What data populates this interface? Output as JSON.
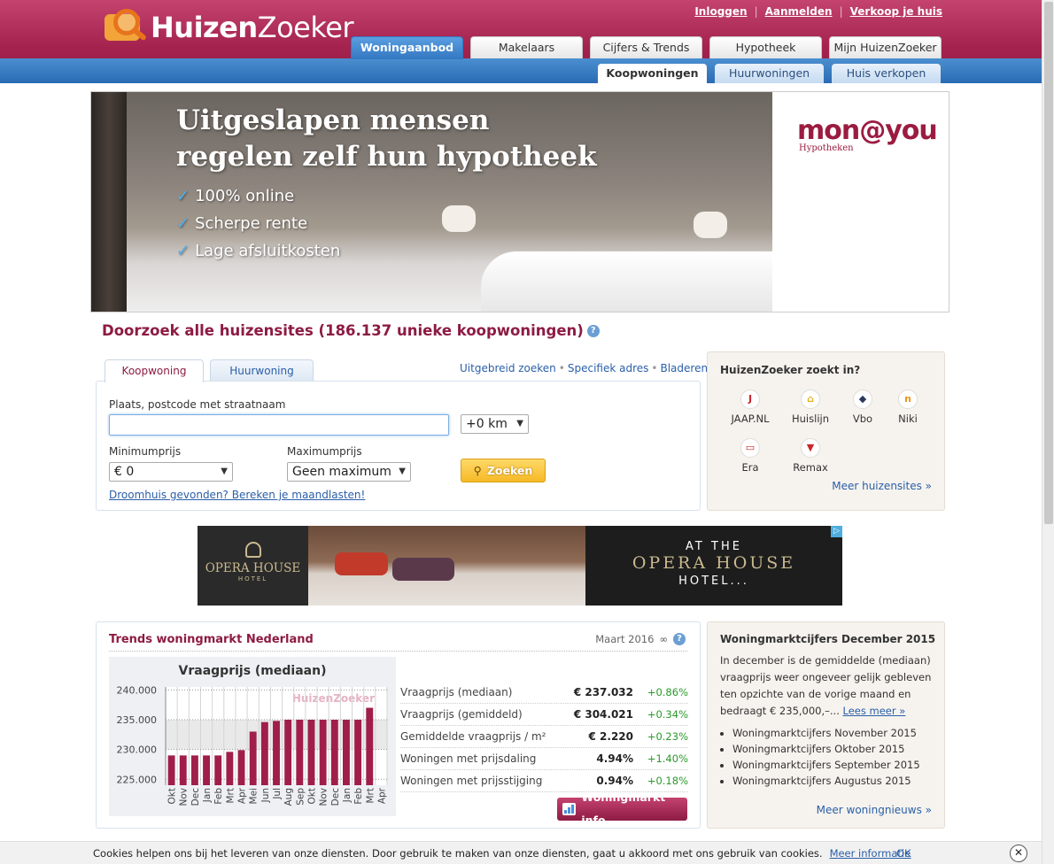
{
  "header": {
    "brand_bold": "Huizen",
    "brand_light": "Zoeker",
    "links": [
      "Inloggen",
      "Aanmelden",
      "Verkoop je huis"
    ],
    "separator": "|",
    "main_tabs": [
      "Woningaanbod",
      "Makelaars",
      "Cijfers & Trends",
      "Hypotheek",
      "Mijn HuizenZoeker"
    ],
    "sub_tabs": [
      "Koopwoningen",
      "Huurwoningen",
      "Huis verkopen"
    ]
  },
  "banner": {
    "headline_1": "Uitgeslapen mensen",
    "headline_2": "regelen zelf hun hypotheek",
    "check_mark": "✓",
    "points": [
      "100% online",
      "Scherpe rente",
      "Lage afsluitkosten"
    ],
    "brand": "mon@you",
    "brand_sub": "Hypotheken"
  },
  "search": {
    "title": "Doorzoek alle huizensites (186.137 unieke koopwoningen)",
    "help_icon": "?",
    "tabs": [
      "Koopwoning",
      "Huurwoning"
    ],
    "links": [
      "Uitgebreid zoeken",
      "Specifiek adres",
      "Bladeren"
    ],
    "link_separator": "•",
    "place_label": "Plaats, postcode met straatnaam",
    "place_value": "",
    "distance": "+0 km",
    "min_label": "Minimumprijs",
    "min_value": "€ 0",
    "max_label": "Maximumprijs",
    "max_value": "Geen maximum",
    "search_button": "Zoeken",
    "dream_link": "Droomhuis gevonden? Bereken je maandlasten!"
  },
  "sites": {
    "title": "HuizenZoeker zoekt in?",
    "items": [
      {
        "name": "JAAP.NL",
        "icon": "J",
        "color": "#c8262a"
      },
      {
        "name": "Huislijn",
        "icon": "⌂",
        "color": "#e3b21c"
      },
      {
        "name": "Vbo",
        "icon": "◆",
        "color": "#2a3a5e"
      },
      {
        "name": "Niki",
        "icon": "n",
        "color": "#e8961c"
      },
      {
        "name": "Era",
        "icon": "▭",
        "color": "#c8262a"
      },
      {
        "name": "Remax",
        "icon": "▼",
        "color": "#c8262a"
      }
    ],
    "more": "Meer huizensites »"
  },
  "ad": {
    "logo_name": "OPERA HOUSE",
    "logo_sub": "HOTEL",
    "line1": "AT THE",
    "line2": "OPERA HOUSE",
    "line3": "HOTEL...",
    "adchoice": "▷"
  },
  "trends": {
    "title": "Trends woningmarkt Nederland",
    "date": "Maart 2016",
    "link_icon": "∞",
    "stats": [
      {
        "label": "Vraagprijs (mediaan)",
        "value": "€ 237.032",
        "change": "+0.86%"
      },
      {
        "label": "Vraagprijs (gemiddeld)",
        "value": "€ 304.021",
        "change": "+0.34%"
      },
      {
        "label": "Gemiddelde vraagprijs / m²",
        "value": "€ 2.220",
        "change": "+0.23%"
      },
      {
        "label": "Woningen met prijsdaling",
        "value": "4.94%",
        "change": "+1.40%"
      },
      {
        "label": "Woningen met prijsstijging",
        "value": "0.94%",
        "change": "+0.18%"
      }
    ],
    "button": "Woningmarkt info"
  },
  "chart_data": {
    "type": "bar",
    "title": "Vraagprijs (mediaan)",
    "watermark": "HuizenZoeker",
    "categories": [
      "Okt",
      "Nov",
      "Dec",
      "Jan",
      "Feb",
      "Mrt",
      "Apr",
      "Mei",
      "Jun",
      "Jul",
      "Aug",
      "Sep",
      "Okt",
      "Nov",
      "Dec",
      "Jan",
      "Feb",
      "Mrt",
      "Apr"
    ],
    "values": [
      229.0,
      229.0,
      229.0,
      229.0,
      229.0,
      229.6,
      229.9,
      233.0,
      234.6,
      234.8,
      235.0,
      235.0,
      235.0,
      235.0,
      235.0,
      235.0,
      235.0,
      237.0,
      0
    ],
    "ylim": [
      224.0,
      240.5
    ],
    "yticks": [
      225,
      230,
      235,
      240
    ],
    "ytick_labels": [
      "225.000",
      "230.000",
      "235.000",
      "240.000"
    ],
    "bar_color": "#a01e4a"
  },
  "news": {
    "title": "Woningmarktcijfers December 2015",
    "body": "In december is de gemiddelde (mediaan) vraagprijs weer ongeveer gelijk gebleven ten opzichte van de vorige maand en bedraagt € 235,000,–...",
    "read_more": "Lees meer »",
    "items": [
      "Woningmarktcijfers November 2015",
      "Woningmarktcijfers Oktober 2015",
      "Woningmarktcijfers September 2015",
      "Woningmarktcijfers Augustus 2015"
    ],
    "more": "Meer woningnieuws »"
  },
  "cookie": {
    "message": "Cookies helpen ons bij het leveren van onze diensten. Door gebruik te maken van onze diensten, gaat u akkoord met ons gebruik van cookies.",
    "more_info": "Meer informatie",
    "ok": "OK",
    "close": "✕"
  }
}
